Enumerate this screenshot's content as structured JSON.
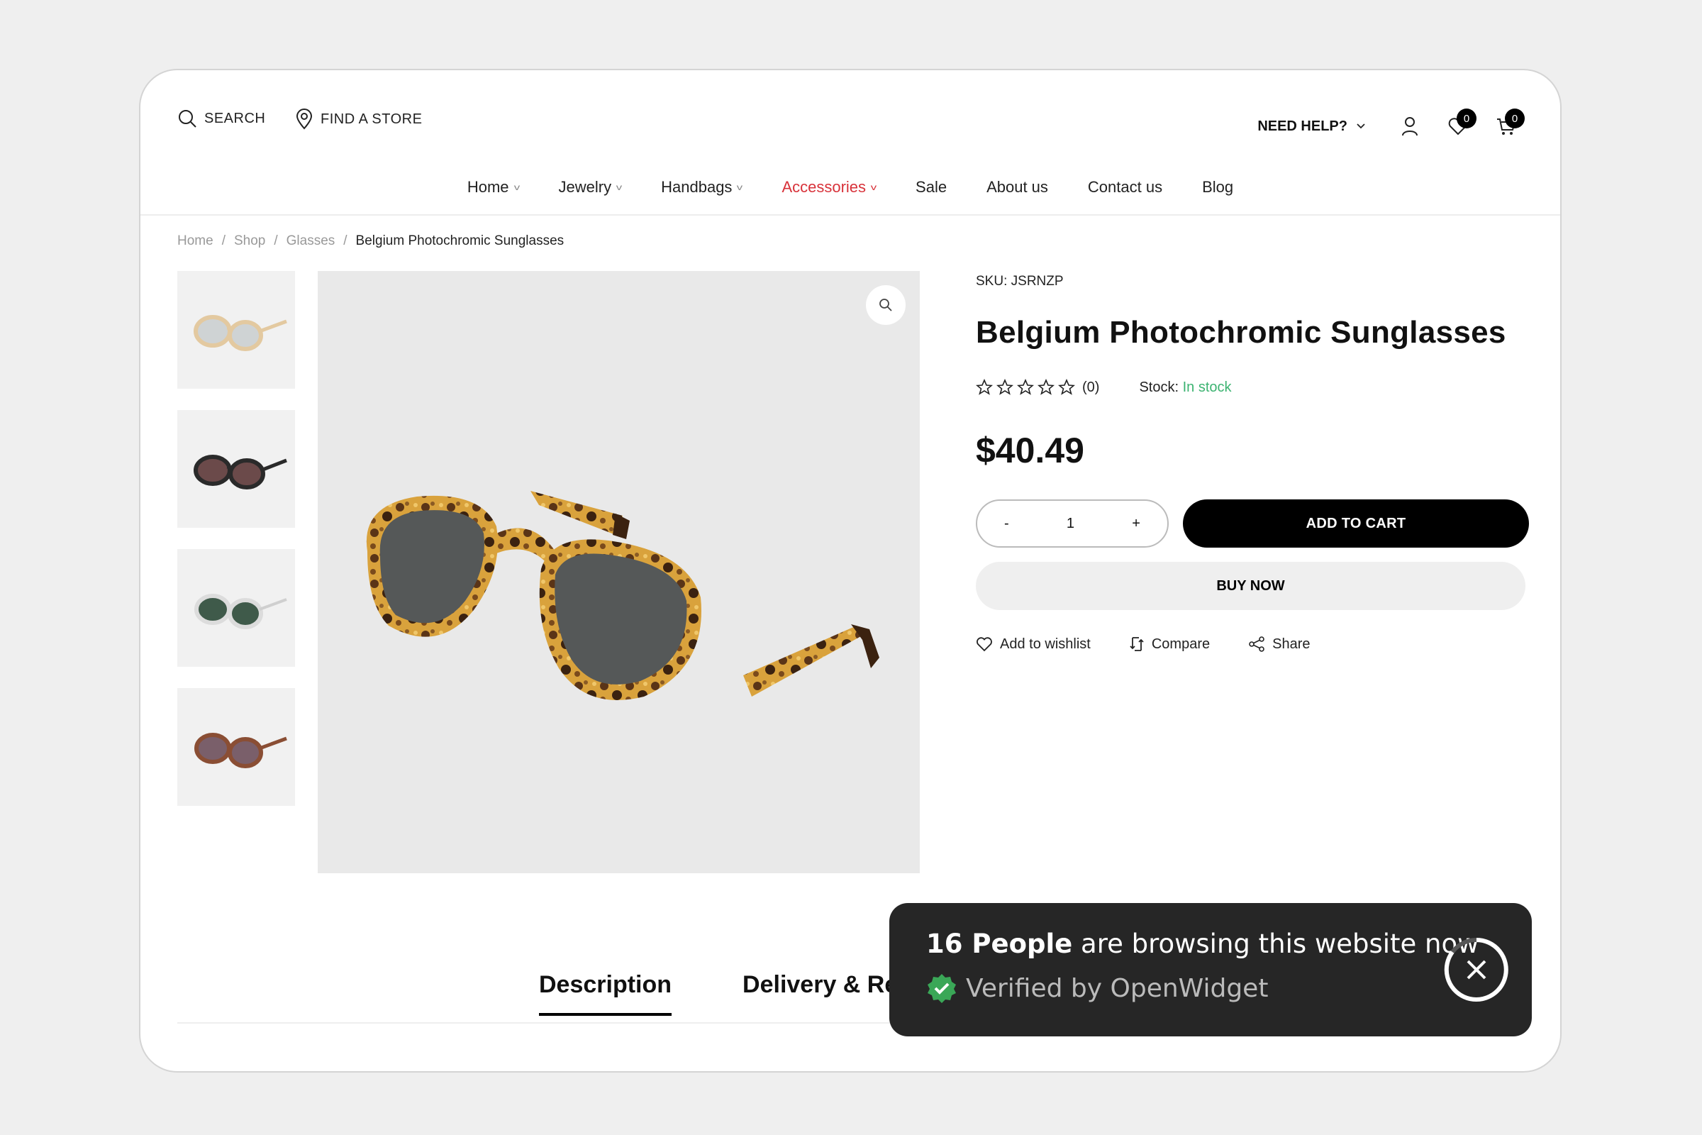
{
  "topbar": {
    "search_label": "SEARCH",
    "store_label": "FIND A STORE",
    "help_label": "NEED HELP?",
    "wishlist_count": "0",
    "cart_count": "0"
  },
  "nav": {
    "items": [
      {
        "label": "Home",
        "has_dropdown": true,
        "active": false
      },
      {
        "label": "Jewelry",
        "has_dropdown": true,
        "active": false
      },
      {
        "label": "Handbags",
        "has_dropdown": true,
        "active": false
      },
      {
        "label": "Accessories",
        "has_dropdown": true,
        "active": true
      },
      {
        "label": "Sale",
        "has_dropdown": false,
        "active": false
      },
      {
        "label": "About us",
        "has_dropdown": false,
        "active": false
      },
      {
        "label": "Contact us",
        "has_dropdown": false,
        "active": false
      },
      {
        "label": "Blog",
        "has_dropdown": false,
        "active": false
      }
    ],
    "accent_color": "#d8323a"
  },
  "breadcrumb": {
    "items": [
      "Home",
      "Shop",
      "Glasses"
    ],
    "separator": "/",
    "current": "Belgium Photochromic Sunglasses"
  },
  "product": {
    "sku_label": "SKU:",
    "sku": "JSRNZP",
    "title": "Belgium Photochromic Sunglasses",
    "rating_count": "(0)",
    "stars": 0,
    "stock_label": "Stock:",
    "stock_value": "In stock",
    "stock_color": "#3cb371",
    "price": "$40.49",
    "qty_minus": "-",
    "qty_value": "1",
    "qty_plus": "+",
    "add_to_cart": "ADD TO CART",
    "buy_now": "BUY NOW",
    "actions": {
      "wishlist": "Add to wishlist",
      "compare": "Compare",
      "share": "Share"
    }
  },
  "gallery": {
    "thumbnails": [
      {
        "name": "tortoise-light-frame",
        "lens": "#cfd3d4",
        "frame": "#e3c9a0"
      },
      {
        "name": "black-frame",
        "lens": "#6b4a4a",
        "frame": "#2a2a2a"
      },
      {
        "name": "clear-frame",
        "lens": "#3f5a4a",
        "frame": "#dcdcdc"
      },
      {
        "name": "tortoise-dark-frame",
        "lens": "#7a5f6a",
        "frame": "#8a4e34"
      }
    ]
  },
  "tabs": {
    "items": [
      "Description",
      "Delivery & Re"
    ]
  },
  "widget": {
    "count_bold": "16 People",
    "count_rest": " are browsing this website now",
    "verified": "Verified by OpenWidget",
    "verified_color": "#3aa757"
  }
}
